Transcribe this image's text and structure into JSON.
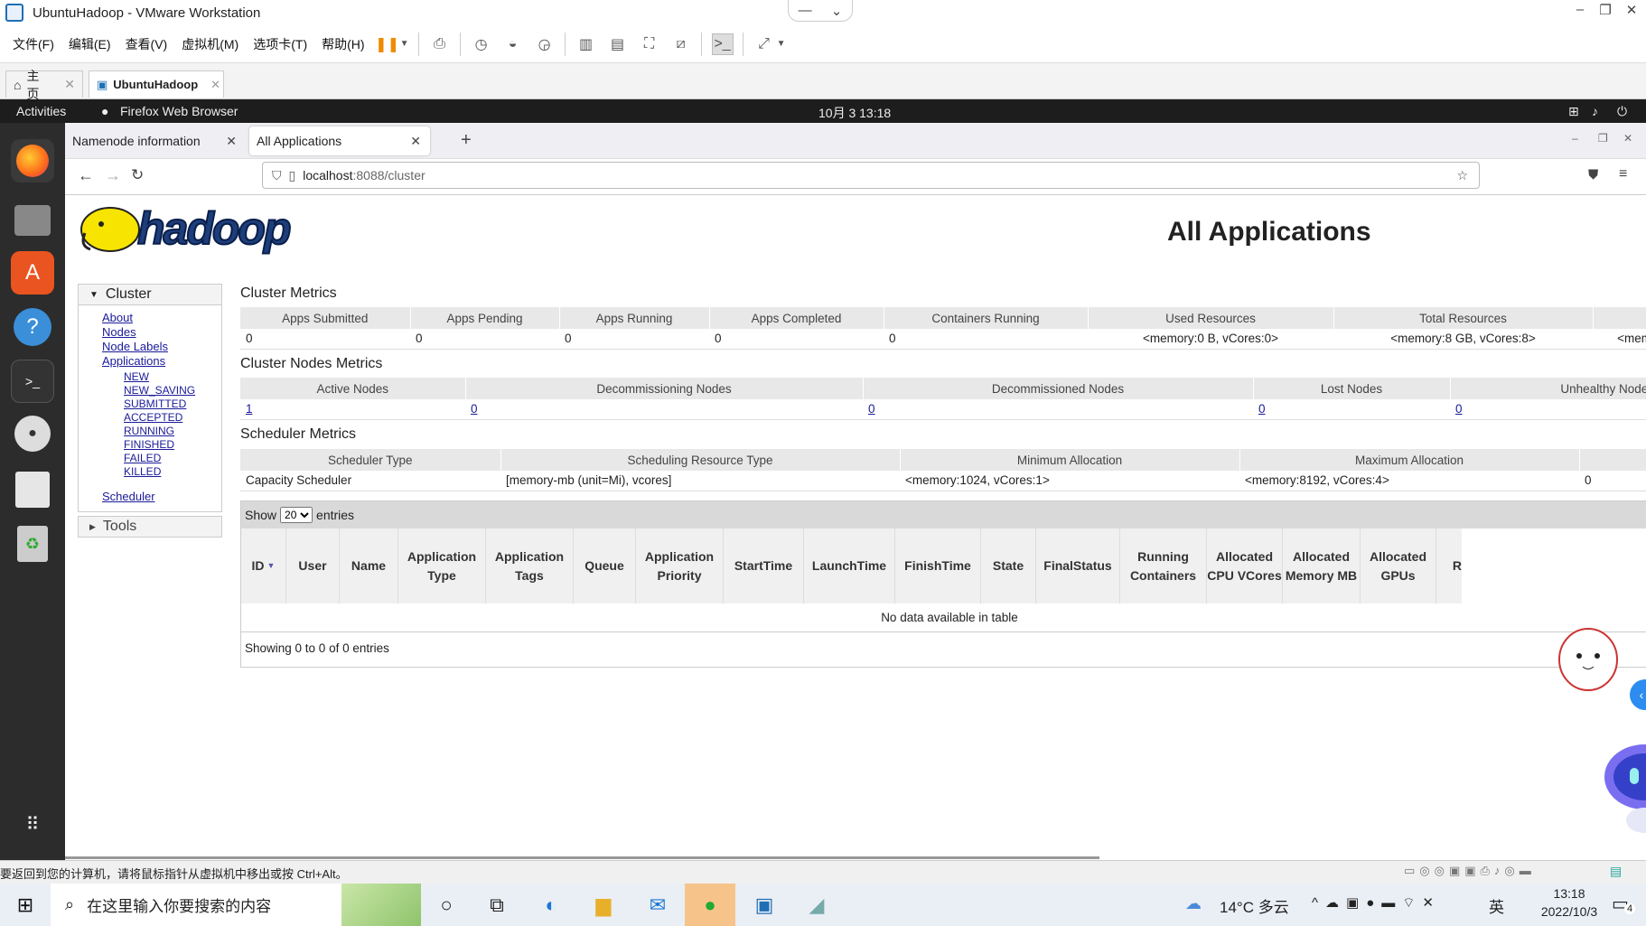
{
  "vmware": {
    "title": "UbuntuHadoop - VMware Workstation",
    "menu": [
      "文件(F)",
      "编辑(E)",
      "查看(V)",
      "虚拟机(M)",
      "选项卡(T)",
      "帮助(H)"
    ],
    "tabs": [
      {
        "label": "主页"
      },
      {
        "label": "UbuntuHadoop"
      }
    ],
    "status_text": "要返回到您的计算机，请将鼠标指针从虚拟机中移出或按 Ctrl+Alt。"
  },
  "gnome": {
    "activities": "Activities",
    "app": "Firefox Web Browser",
    "clock": "10月 3  13:18"
  },
  "firefox": {
    "tabs": [
      {
        "label": "Namenode information"
      },
      {
        "label": "All Applications"
      }
    ],
    "url_host": "localhost",
    "url_rest": ":8088/cluster"
  },
  "page": {
    "logo_text": "hadoop",
    "heading": "All Applications",
    "sidebar": {
      "cluster": "Cluster",
      "links": [
        "About",
        "Nodes",
        "Node Labels",
        "Applications"
      ],
      "app_states": [
        "NEW",
        "NEW_SAVING",
        "SUBMITTED",
        "ACCEPTED",
        "RUNNING",
        "FINISHED",
        "FAILED",
        "KILLED"
      ],
      "scheduler": "Scheduler",
      "tools": "Tools"
    },
    "cluster_metrics": {
      "title": "Cluster Metrics",
      "headers": [
        "Apps Submitted",
        "Apps Pending",
        "Apps Running",
        "Apps Completed",
        "Containers Running",
        "Used Resources",
        "Total Resources",
        ""
      ],
      "values": [
        "0",
        "0",
        "0",
        "0",
        "0",
        "<memory:0 B, vCores:0>",
        "<memory:8 GB, vCores:8>",
        "<memo"
      ]
    },
    "nodes_metrics": {
      "title": "Cluster Nodes Metrics",
      "headers": [
        "Active Nodes",
        "Decommissioning Nodes",
        "Decommissioned Nodes",
        "Lost Nodes",
        "Unhealthy Nodes"
      ],
      "values": [
        "1",
        "0",
        "0",
        "0",
        "0"
      ]
    },
    "scheduler_metrics": {
      "title": "Scheduler Metrics",
      "headers": [
        "Scheduler Type",
        "Scheduling Resource Type",
        "Minimum Allocation",
        "Maximum Allocation",
        ""
      ],
      "values": [
        "Capacity Scheduler",
        "[memory-mb (unit=Mi), vcores]",
        "<memory:1024, vCores:1>",
        "<memory:8192, vCores:4>",
        "0"
      ]
    },
    "apps_table": {
      "show": "Show",
      "entries_value": "20",
      "entries": "entries",
      "columns": [
        "ID",
        "User",
        "Name",
        "Application Type",
        "Application Tags",
        "Queue",
        "Application Priority",
        "StartTime",
        "LaunchTime",
        "FinishTime",
        "State",
        "FinalStatus",
        "Running Containers",
        "Allocated CPU VCores",
        "Allocated Memory MB",
        "Allocated GPUs",
        "R"
      ],
      "empty": "No data available in table",
      "info": "Showing 0 to 0 of 0 entries"
    }
  },
  "taskbar": {
    "search_placeholder": "在这里输入你要搜索的内容",
    "weather": "14°C  多云",
    "ime": "英",
    "time": "13:18",
    "date": "2022/10/3",
    "notif_count": "4"
  }
}
